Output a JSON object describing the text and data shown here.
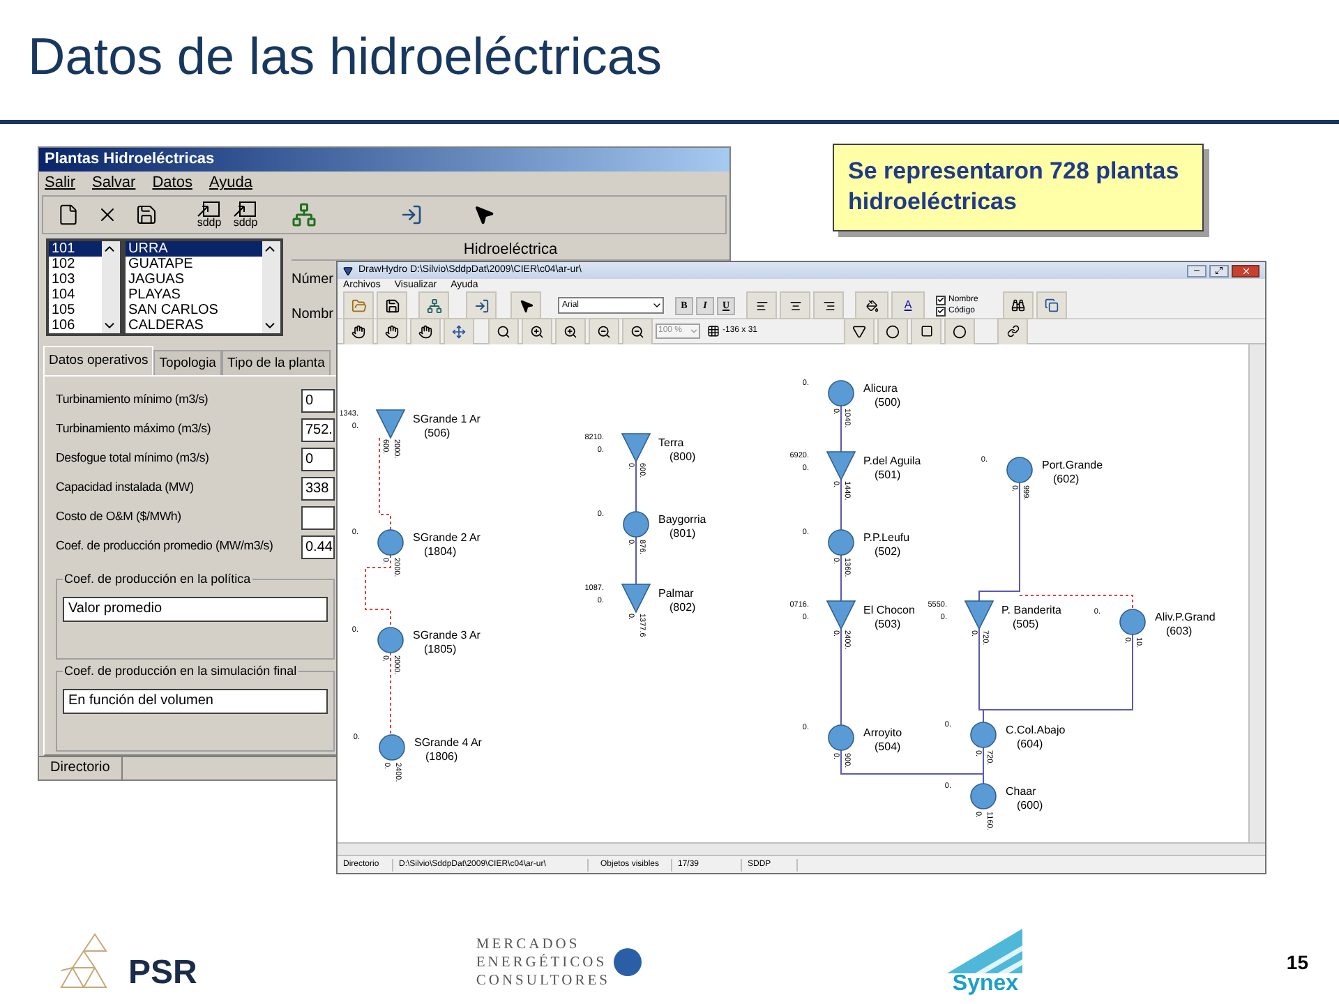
{
  "slide": {
    "title": "Datos de las hidroeléctricas",
    "page_number": "15"
  },
  "callout": "Se representaron 728 plantas hidroeléctricas",
  "plantas_window": {
    "title": "Plantas Hidroeléctricas",
    "menu": [
      "Salir",
      "Salvar",
      "Datos",
      "Ayuda"
    ],
    "toolbar_labels": [
      "sddp",
      "sddp"
    ],
    "codes": [
      {
        "text": "101",
        "selected": true
      },
      {
        "text": "102",
        "selected": false
      },
      {
        "text": "103",
        "selected": false
      },
      {
        "text": "104",
        "selected": false
      },
      {
        "text": "105",
        "selected": false
      },
      {
        "text": "106",
        "selected": false
      }
    ],
    "names": [
      {
        "text": "URRA",
        "selected": true
      },
      {
        "text": "GUATAPE",
        "selected": false
      },
      {
        "text": "JAGUAS",
        "selected": false
      },
      {
        "text": "PLAYAS",
        "selected": false
      },
      {
        "text": "SAN CARLOS",
        "selected": false
      },
      {
        "text": "CALDERAS",
        "selected": false
      }
    ],
    "section_title": "Hidroeléctrica",
    "field_labels": [
      "Númer",
      "Nombr"
    ],
    "tabs": [
      {
        "label": "Datos operativos",
        "selected": true
      },
      {
        "label": "Topologia",
        "selected": false
      },
      {
        "label": "Tipo de la planta",
        "selected": false
      }
    ],
    "fields": [
      {
        "label": "Turbinamiento mínimo (m3/s)",
        "value": "0"
      },
      {
        "label": "Turbinamiento máximo (m3/s)",
        "value": "752."
      },
      {
        "label": "Desfogue total mínimo (m3/s)",
        "value": "0"
      },
      {
        "label": "Capacidad instalada (MW)",
        "value": "338"
      },
      {
        "label": "Costo de O&M ($/MWh)"
      },
      {
        "label": "Coef. de producción promedio (MW/m3/s)",
        "value": "0.44"
      }
    ],
    "groups": [
      {
        "title": "Coef. de producción en la política",
        "value": "Valor promedio"
      },
      {
        "title": "Coef. de producción en la simulación final",
        "value": "En función del volumen"
      }
    ],
    "status_bar": "Directorio"
  },
  "drawhydro_window": {
    "title": "DrawHydro D:\\Silvio\\SddpDat\\2009\\CIER\\c04\\ar-ur\\",
    "menu": [
      "Archivos",
      "Visualizar",
      "Ayuda"
    ],
    "font_name": "Arial",
    "format_buttons": [
      "B",
      "I",
      "U"
    ],
    "text_color_button": "A",
    "checks": [
      {
        "label": "Nombre",
        "checked": true
      },
      {
        "label": "Código",
        "checked": true
      }
    ],
    "zoom": "100 %",
    "size": "-136 x 31",
    "nodes": [
      {
        "kind": "reservoir",
        "name": "SGrande 1 Ar",
        "code": "(506)",
        "side": [
          "1343.",
          "0."
        ],
        "flows": [
          "600.",
          "2000."
        ]
      },
      {
        "kind": "plant",
        "name": "SGrande 2 Ar",
        "code": "(1804)",
        "side": [
          "0."
        ],
        "flows": [
          "0.",
          "2000."
        ]
      },
      {
        "kind": "plant",
        "name": "SGrande 3 Ar",
        "code": "(1805)",
        "side": [
          "0."
        ],
        "flows": [
          "0.",
          "2000."
        ]
      },
      {
        "kind": "plant",
        "name": "SGrande 4 Ar",
        "code": "(1806)",
        "side": [
          "0."
        ],
        "flows": [
          "0.",
          "2400."
        ]
      },
      {
        "kind": "reservoir",
        "name": "Terra",
        "code": "(800)",
        "side": [
          "8210.",
          "0."
        ],
        "flows": [
          "0.",
          "600."
        ]
      },
      {
        "kind": "plant",
        "name": "Baygorria",
        "code": "(801)",
        "side": [
          "0."
        ],
        "flows": [
          "0.",
          "876."
        ]
      },
      {
        "kind": "reservoir",
        "name": "Palmar",
        "code": "(802)",
        "side": [
          "1087.",
          "0."
        ],
        "flows": [
          "0.",
          "1377.6"
        ]
      },
      {
        "kind": "plant",
        "name": "Alicura",
        "code": "(500)",
        "side": [
          "0."
        ],
        "flows": [
          "0.",
          "1040."
        ]
      },
      {
        "kind": "reservoir",
        "name": "P.del Aguila",
        "code": "(501)",
        "side": [
          "6920.",
          "0."
        ],
        "flows": [
          "0.",
          "1440."
        ]
      },
      {
        "kind": "plant",
        "name": "P.P.Leufu",
        "code": "(502)",
        "side": [
          "0."
        ],
        "flows": [
          "0.",
          "1360."
        ]
      },
      {
        "kind": "reservoir",
        "name": "El Chocon",
        "code": "(503)",
        "side": [
          "0716.",
          "0."
        ],
        "flows": [
          "0.",
          "2400."
        ]
      },
      {
        "kind": "plant",
        "name": "Arroyito",
        "code": "(504)",
        "side": [
          "0."
        ],
        "flows": [
          "0.",
          "900."
        ]
      },
      {
        "kind": "plant",
        "name": "Port.Grande",
        "code": "(602)",
        "side": [
          "0."
        ],
        "flows": [
          "0.",
          "999."
        ]
      },
      {
        "kind": "reservoir",
        "name": "P. Banderita",
        "code": "(505)",
        "side": [
          "5550.",
          "0."
        ],
        "flows": [
          "0.",
          "720."
        ]
      },
      {
        "kind": "plant",
        "name": "Aliv.P.Grand",
        "code": "(603)",
        "side": [
          "0."
        ],
        "flows": [
          "0.",
          "10."
        ]
      },
      {
        "kind": "plant",
        "name": "C.Col.Abajo",
        "code": "(604)",
        "side": [
          "0."
        ],
        "flows": [
          "0.",
          "720."
        ]
      },
      {
        "kind": "plant",
        "name": "Chaar",
        "code": "(600)",
        "side": [
          "0."
        ],
        "flows": [
          "0.",
          "1160."
        ]
      }
    ],
    "status_bar": [
      "Directorio",
      "D:\\Silvio\\SddpDat\\2009\\CIER\\c04\\ar-ur\\",
      "Objetos visibles",
      "17/39",
      "SDDP"
    ]
  },
  "logos": {
    "psr": "PSR",
    "mercados": [
      "MERCADOS",
      "ENERGÉTICOS",
      "CONSULTORES"
    ],
    "synex": "Synex"
  }
}
